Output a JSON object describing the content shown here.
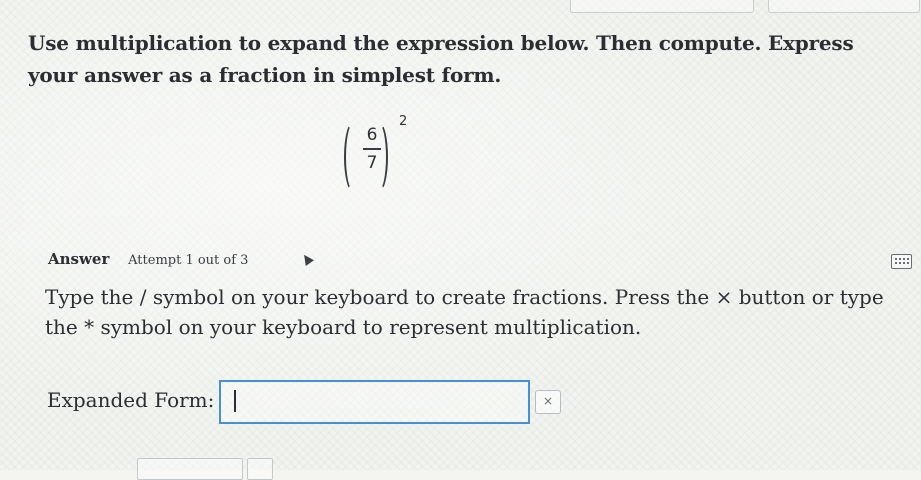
{
  "question": {
    "text": "Use multiplication to expand the expression below. Then compute. Express your answer as a fraction in simplest form."
  },
  "expression": {
    "numerator": "6",
    "denominator": "7",
    "exponent": "2"
  },
  "answer": {
    "label": "Answer",
    "attempt": "Attempt 1 out of 3"
  },
  "instructions": {
    "text": "Type the / symbol on your keyboard to create fractions. Press the × button or type the * symbol on your keyboard to represent multiplication."
  },
  "expanded_form": {
    "label": "Expanded Form:",
    "value": "",
    "times_button": "×"
  },
  "icons": {
    "keyboard": "keyboard-icon",
    "cursor": "mouse-pointer-icon"
  }
}
